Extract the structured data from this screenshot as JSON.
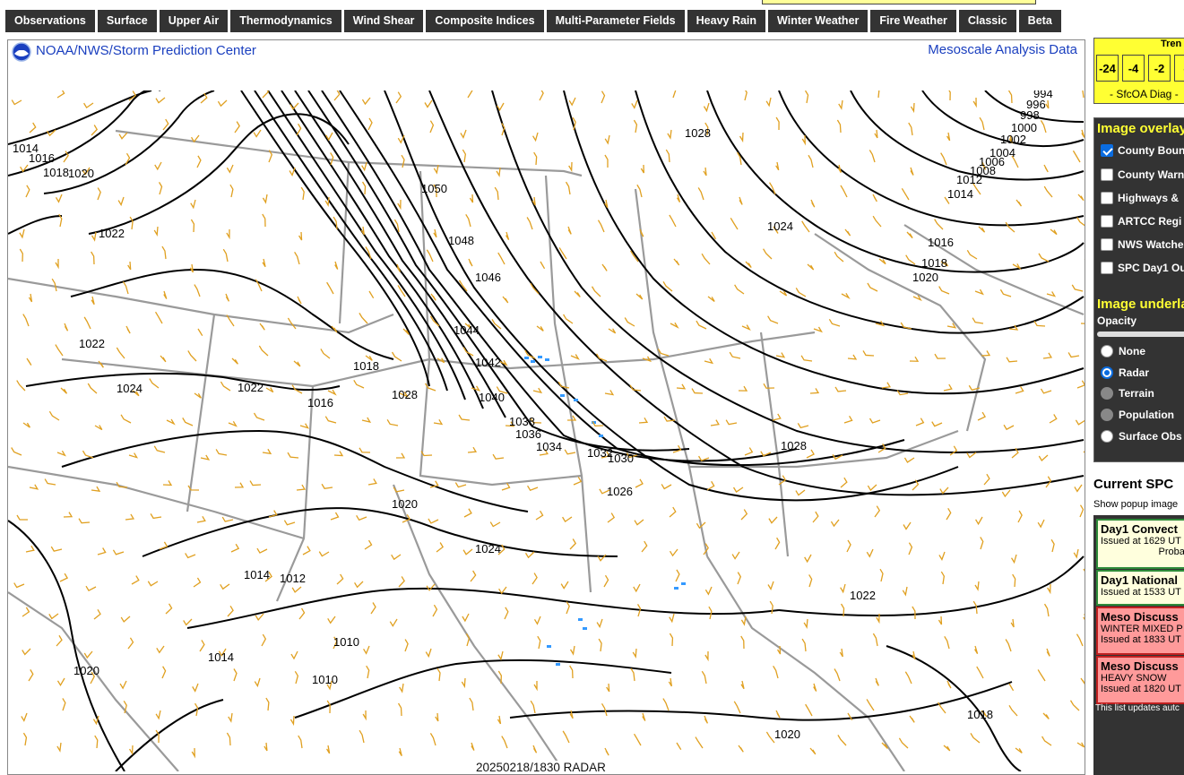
{
  "nav": {
    "tabs": [
      "Observations",
      "Surface",
      "Upper Air",
      "Thermodynamics",
      "Wind Shear",
      "Composite Indices",
      "Multi-Parameter Fields",
      "Heavy Rain",
      "Winter Weather",
      "Fire Weather",
      "Classic",
      "Beta"
    ]
  },
  "header": {
    "logo_icon": "noaa-logo-icon",
    "title": "NOAA/NWS/Storm Prediction Center",
    "right_title": "Mesoscale Analysis Data"
  },
  "map": {
    "contour_labels": [
      "994",
      "996",
      "998",
      "1000",
      "1002",
      "1004",
      "1006",
      "1008",
      "1010",
      "1012",
      "1014",
      "1016",
      "1018",
      "1020",
      "1022",
      "1024",
      "1026",
      "1028",
      "1030",
      "1032",
      "1034",
      "1036",
      "1038",
      "1040",
      "1042",
      "1044",
      "1046",
      "1048",
      "1050"
    ],
    "timestamp": "20250218/1830 RADAR",
    "colors": {
      "isobar": "#000000",
      "borders": "#9a9a9a",
      "wind_barbs": "#e0a020",
      "radar": "#3399ff"
    }
  },
  "trend": {
    "title": "Tren",
    "cells": [
      "-24",
      "-4",
      "-2",
      "-"
    ],
    "footer": "- SfcOA Diag -"
  },
  "overlays": {
    "title": "Image overlay",
    "items": [
      {
        "label": "County Boun",
        "checked": true
      },
      {
        "label": "County Warn",
        "checked": false
      },
      {
        "label": "Highways & ",
        "checked": false
      },
      {
        "label": "ARTCC Regi",
        "checked": false
      },
      {
        "label": "NWS Watche",
        "checked": false
      },
      {
        "label": "SPC Day1 Ou",
        "checked": false
      }
    ]
  },
  "underlays": {
    "title": "Image underla",
    "opacity_label": "Opacity",
    "options": [
      {
        "label": "None",
        "selected": false
      },
      {
        "label": "Radar",
        "selected": true
      },
      {
        "label": "Terrain",
        "selected": false
      },
      {
        "label": "Population",
        "selected": false
      },
      {
        "label": "Surface Obs",
        "selected": false
      }
    ]
  },
  "products": {
    "title": "Current SPC",
    "note": "Show popup image",
    "items": [
      {
        "title": "Day1 Convect",
        "line1": "Issued at 1629 UT",
        "line2": "Probab",
        "bg": "#ffffdd",
        "border": "#2e8b3a"
      },
      {
        "title": "Day1 National",
        "line1": "Issued at 1533 UT",
        "line2": "",
        "bg": "#ffffdd",
        "border": "#2e8b3a"
      },
      {
        "title": "Meso Discuss",
        "line1": "WINTER MIXED P",
        "line2": "Issued at 1833 UT",
        "bg": "#ff9a9a",
        "border": "#c02020"
      },
      {
        "title": "Meso Discuss",
        "line1": "HEAVY SNOW",
        "line2": "Issued at 1820 UT",
        "bg": "#ff9a9a",
        "border": "#c02020"
      }
    ],
    "footer": "This list updates autc"
  }
}
